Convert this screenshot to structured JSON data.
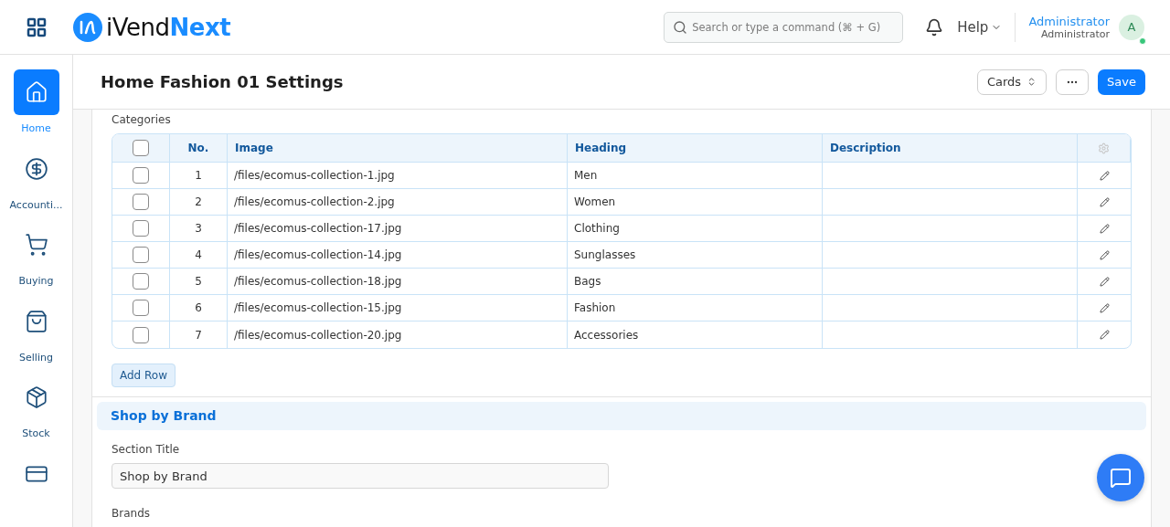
{
  "brand": {
    "name_part1": "iVend",
    "name_part2": "Next"
  },
  "search": {
    "placeholder": "Search or type a command (⌘ + G)"
  },
  "help": {
    "label": "Help"
  },
  "user": {
    "name": "Administrator",
    "role": "Administrator",
    "initial": "A",
    "online": true
  },
  "sidebar": {
    "items": [
      {
        "kind": "home",
        "label": "Home",
        "selected": true
      },
      {
        "kind": "dollar",
        "label": "Accounti...",
        "selected": false
      },
      {
        "kind": "cart",
        "label": "Buying",
        "selected": false
      },
      {
        "kind": "bag",
        "label": "Selling",
        "selected": false
      },
      {
        "kind": "box",
        "label": "Stock",
        "selected": false
      },
      {
        "kind": "pos",
        "selected": false
      }
    ]
  },
  "page": {
    "title": "Home Fashion 01 Settings",
    "view_button": "Cards",
    "save_button": "Save"
  },
  "categories": {
    "label": "Categories",
    "all_checked": false,
    "columns": [
      "No.",
      "Image",
      "Heading",
      "Description"
    ],
    "rows": [
      {
        "no": "1",
        "image": "/files/ecomus-collection-1.jpg",
        "heading": "Men",
        "checked": false
      },
      {
        "no": "2",
        "image": "/files/ecomus-collection-2.jpg",
        "heading": "Women",
        "checked": false
      },
      {
        "no": "3",
        "image": "/files/ecomus-collection-17.jpg",
        "heading": "Clothing",
        "checked": false
      },
      {
        "no": "4",
        "image": "/files/ecomus-collection-14.jpg",
        "heading": "Sunglasses",
        "checked": false
      },
      {
        "no": "5",
        "image": "/files/ecomus-collection-18.jpg",
        "heading": "Bags",
        "checked": false
      },
      {
        "no": "6",
        "image": "/files/ecomus-collection-15.jpg",
        "heading": "Fashion",
        "checked": false
      },
      {
        "no": "7",
        "image": "/files/ecomus-collection-20.jpg",
        "heading": "Accessories",
        "checked": false
      }
    ],
    "add_row": "Add Row"
  },
  "shop_by_brand": {
    "heading": "Shop by Brand",
    "field_label": "Section Title",
    "field_value": "Shop by Brand",
    "next_label": "Brands"
  }
}
